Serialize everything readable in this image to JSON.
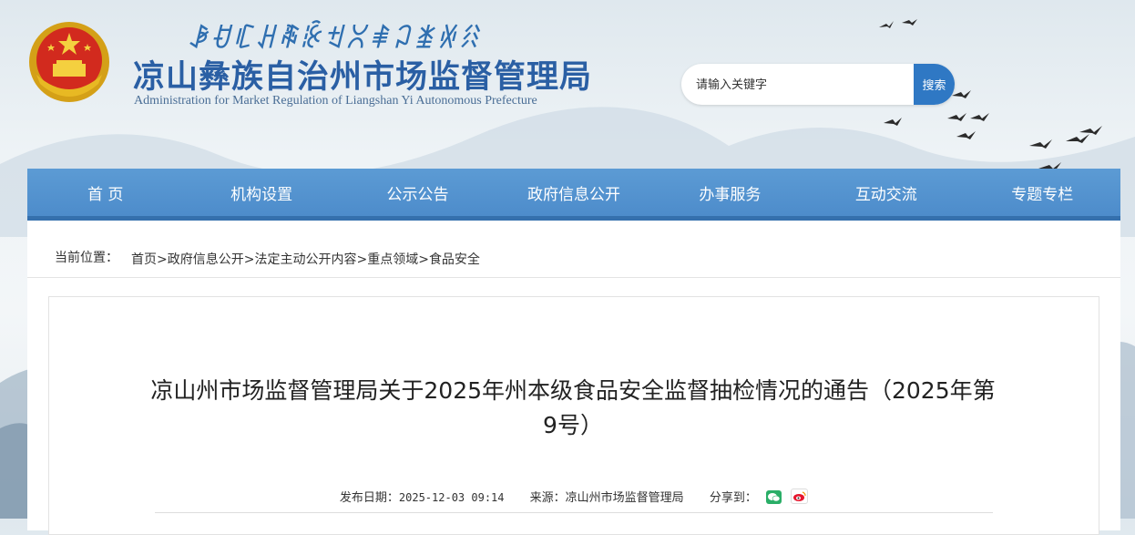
{
  "header": {
    "yi_name": "ꆃꀀꏸꃅꎹꊬꉬꇤꑌꃀꁧꏾꋧ",
    "title": "凉山彝族自治州市场监督管理局",
    "subtitle": "Administration for Market Regulation of Liangshan Yi Autonomous Prefecture",
    "emblem_icon": "national-emblem-icon"
  },
  "search": {
    "placeholder": "请输入关键字",
    "button_label": "搜索"
  },
  "nav": [
    {
      "label": "首 页"
    },
    {
      "label": "机构设置"
    },
    {
      "label": "公示公告"
    },
    {
      "label": "政府信息公开"
    },
    {
      "label": "办事服务"
    },
    {
      "label": "互动交流"
    },
    {
      "label": "专题专栏"
    }
  ],
  "breadcrumb": {
    "label": "当前位置：",
    "items": [
      "首页",
      "政府信息公开",
      "法定主动公开内容",
      "重点领域",
      "食品安全"
    ],
    "separator": ">"
  },
  "article": {
    "title": "凉山州市场监督管理局关于2025年州本级食品安全监督抽检情况的通告（2025年第9号）",
    "publish_label": "发布日期：",
    "publish_date": "2025-12-03 09:14",
    "source_label": "来源：",
    "source": "凉山州市场监督管理局",
    "share_label": "分享到：",
    "share_icons": [
      "wechat-icon",
      "weibo-icon"
    ]
  },
  "colors": {
    "brand_blue": "#2a5fa4",
    "nav_blue": "#4d8ccb",
    "search_button": "#2f78c4",
    "wechat_green": "#2aae67",
    "weibo_red": "#e6162d"
  }
}
